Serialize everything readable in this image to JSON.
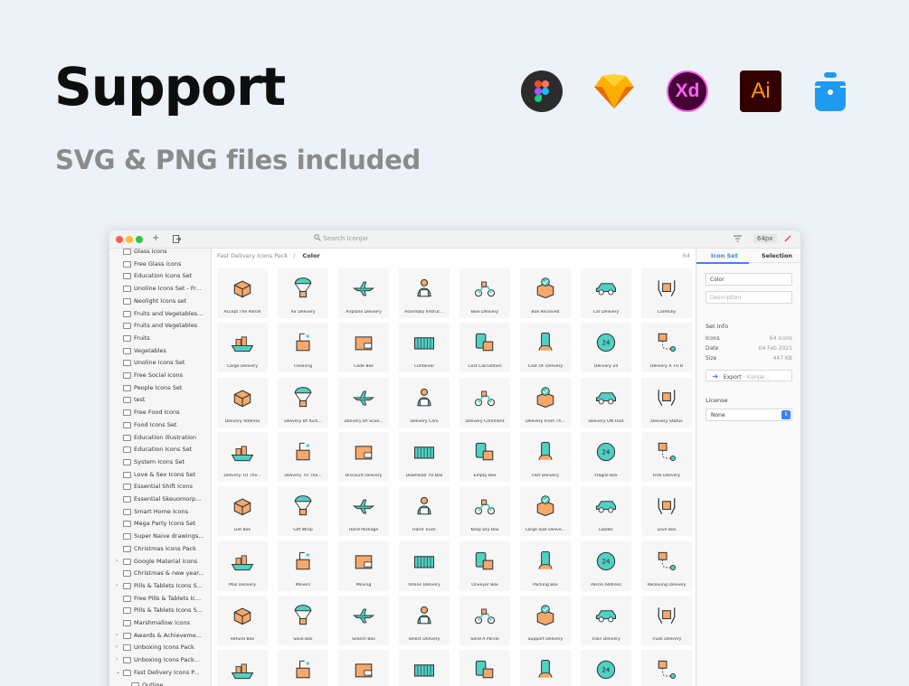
{
  "hero": {
    "title": "Support",
    "subtitle": "SVG & PNG files included"
  },
  "apps": {
    "xd": "Xd",
    "ai": "Ai"
  },
  "window": {
    "search_placeholder": "Search IconJar",
    "zoom": "64px",
    "plus": "+"
  },
  "breadcrumb": {
    "pack": "Fast Delivery Icons Pack",
    "separator": "/",
    "current": "Color"
  },
  "icon_count": "64",
  "sidebar": [
    {
      "label": "Glass icons",
      "arrow": ""
    },
    {
      "label": "Free Glass icons",
      "arrow": ""
    },
    {
      "label": "Education Icons Set",
      "arrow": ""
    },
    {
      "label": "Unoline Icons Set - Fr...",
      "arrow": ""
    },
    {
      "label": "Neolight Icons set",
      "arrow": ""
    },
    {
      "label": "Fruits and Vegetables...",
      "arrow": ""
    },
    {
      "label": "Fruits and Vegetables",
      "arrow": ""
    },
    {
      "label": "Fruits",
      "arrow": ""
    },
    {
      "label": "Vegetables",
      "arrow": ""
    },
    {
      "label": "Unoline Icons Set",
      "arrow": ""
    },
    {
      "label": "Free Social icons",
      "arrow": ""
    },
    {
      "label": "People Icons Set",
      "arrow": ""
    },
    {
      "label": "test",
      "arrow": ""
    },
    {
      "label": "Free Food Icons",
      "arrow": ""
    },
    {
      "label": "Food Icons Set",
      "arrow": ""
    },
    {
      "label": "Education illustration",
      "arrow": ""
    },
    {
      "label": "Education Icons Set",
      "arrow": ""
    },
    {
      "label": "System Icons Set",
      "arrow": ""
    },
    {
      "label": "Love & Sex Icons Set",
      "arrow": ""
    },
    {
      "label": "Essential Shift Icons",
      "arrow": ""
    },
    {
      "label": "Essential Skeuomorp...",
      "arrow": ""
    },
    {
      "label": "Smart Home Icons",
      "arrow": ""
    },
    {
      "label": "Mega Party Icons Set",
      "arrow": ""
    },
    {
      "label": "Super Naive drawings...",
      "arrow": ""
    },
    {
      "label": "Christmas Icons Pack",
      "arrow": ""
    },
    {
      "label": "Google Material icons",
      "arrow": "›"
    },
    {
      "label": "Christmas & new year...",
      "arrow": ""
    },
    {
      "label": "Pills & Tablets Icons S...",
      "arrow": "›"
    },
    {
      "label": "Free Pills & Tablets Ic...",
      "arrow": ""
    },
    {
      "label": "Pills & Tablets Icons S...",
      "arrow": ""
    },
    {
      "label": "Marshmallow icons",
      "arrow": ""
    },
    {
      "label": "Awards & Achieveme...",
      "arrow": "›"
    },
    {
      "label": "Unboxing Icons Pack",
      "arrow": "›"
    },
    {
      "label": "Unboxing Icons Pack...",
      "arrow": "›"
    },
    {
      "label": "Fast Delivery Icons P...",
      "arrow": "⌄"
    },
    {
      "label": "Outline",
      "arrow": ""
    }
  ],
  "icons": [
    "Accept The Parcel",
    "Air Delivery",
    "Airplane Delivery",
    "Assembly Instruc...",
    "Bike Delivery",
    "Box Received",
    "Car Delivery",
    "Carefully",
    "Cargo Delivery",
    "Cleaning",
    "Code Box",
    "Container",
    "Cost Calculation",
    "Cost OF Delivery",
    "Delivery 24",
    "Delivery A TO B",
    "Delivery Address",
    "Delivery BY Kick...",
    "Delivery BY Scoo...",
    "Delivery Care",
    "Delivery Comment",
    "Delivery From Th...",
    "Delivery ON Foot",
    "Delivery Status",
    "Delivery TO The...",
    "Delivery TO The...",
    "Discount Delivery",
    "Download TO Box",
    "Empty Box",
    "Fast Delivery",
    "Fragile Box",
    "Free Delivery",
    "Get Box",
    "Gift Wrap",
    "Hand Package",
    "Hand Truck",
    "Keep Dry Box",
    "Large Size Delive...",
    "Loader",
    "Love Box",
    "Mail Delivery",
    "Movers",
    "Moving",
    "Online Delivery",
    "Onveyor Box",
    "Packing Box",
    "Parcel Address",
    "Receiving Delivery",
    "Refund Box",
    "Save Box",
    "Search Box",
    "Select Delivery",
    "Send A Parcel",
    "Support Delivery",
    "Train Delivery",
    "Truck Delivery",
    "",
    "",
    "",
    "",
    "",
    "",
    "",
    ""
  ],
  "panel": {
    "tab_iconset": "Icon Set",
    "tab_selection": "Selection",
    "name_value": "Color",
    "description_placeholder": "Description",
    "set_info_label": "Set Info",
    "rows": [
      {
        "key": "Icons",
        "value": "64 Icons"
      },
      {
        "key": "Date",
        "value": "04 Feb 2021"
      },
      {
        "key": "Size",
        "value": "447 KB"
      }
    ],
    "export_label": "Export",
    "export_target": "IconJar...",
    "license_label": "License",
    "license_value": "None"
  },
  "colors": {
    "accent": "#3a82f7",
    "teal": "#4fd1c5",
    "box": "#f6a96b",
    "outline": "#333333"
  }
}
